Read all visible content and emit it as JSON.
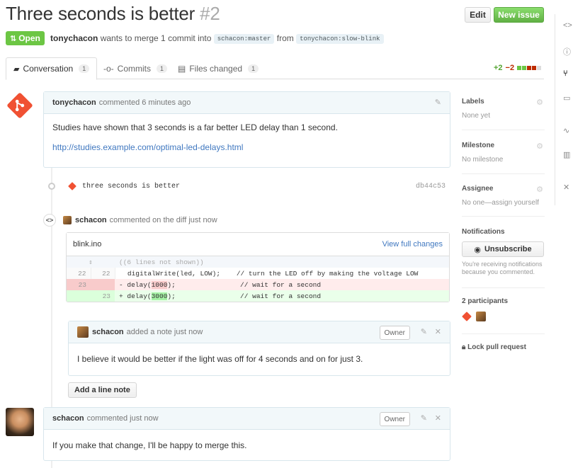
{
  "header": {
    "title": "Three seconds is better",
    "number": "#2",
    "edit_label": "Edit",
    "new_issue_label": "New issue"
  },
  "status": {
    "state_label": "Open",
    "author": "tonychacon",
    "merge_text": "wants to merge 1 commit into",
    "base_ref": "schacon:master",
    "from_text": "from",
    "head_ref": "tonychacon:slow-blink"
  },
  "tabs": [
    {
      "label": "Conversation",
      "count": "1",
      "icon": "comment-discussion-icon"
    },
    {
      "label": "Commits",
      "count": "1",
      "icon": "git-commit-icon"
    },
    {
      "label": "Files changed",
      "count": "1",
      "icon": "diff-icon"
    }
  ],
  "diffstat": {
    "additions": "+2",
    "deletions": "−2",
    "add_color": "#6cc644",
    "del_color": "#bd2c00"
  },
  "first_comment": {
    "author": "tonychacon",
    "meta": "commented 6 minutes ago",
    "body": "Studies have shown that 3 seconds is a far better LED delay than 1 second.",
    "link": "http://studies.example.com/optimal-led-delays.html"
  },
  "commit": {
    "message": "three seconds is better",
    "sha": "db44c53"
  },
  "diff_comment": {
    "author": "schacon",
    "meta": "commented on the diff just now",
    "file": "blink.ino",
    "view_label": "View full changes",
    "hunk": "((6 lines not shown))",
    "lines": [
      {
        "type": "ctx",
        "old": "22",
        "new": "22",
        "text": "  digitalWrite(led, LOW);    // turn the LED off by making the voltage LOW"
      },
      {
        "type": "del",
        "old": "23",
        "new": "",
        "pre": "- delay(",
        "hl": "1000",
        "post": ");                // wait for a second"
      },
      {
        "type": "add",
        "old": "",
        "new": "23",
        "pre": "+ delay(",
        "hl": "3000",
        "post": ");                // wait for a second"
      }
    ]
  },
  "inline_note": {
    "author": "schacon",
    "meta": "added a note just now",
    "owner_label": "Owner",
    "body": "I believe it would be better if the light was off for 4 seconds and on for just 3."
  },
  "add_line_note_label": "Add a line note",
  "last_comment": {
    "author": "schacon",
    "meta": "commented just now",
    "owner_label": "Owner",
    "body": "If you make that change, I'll be happy to merge this."
  },
  "sidebar": {
    "labels": {
      "title": "Labels",
      "value": "None yet"
    },
    "milestone": {
      "title": "Milestone",
      "value": "No milestone"
    },
    "assignee": {
      "title": "Assignee",
      "value": "No one—assign yourself"
    },
    "notifications": {
      "title": "Notifications",
      "button": "Unsubscribe",
      "note": "You're receiving notifications because you commented."
    },
    "participants": {
      "title": "2 participants"
    },
    "lock": "Lock pull request"
  }
}
